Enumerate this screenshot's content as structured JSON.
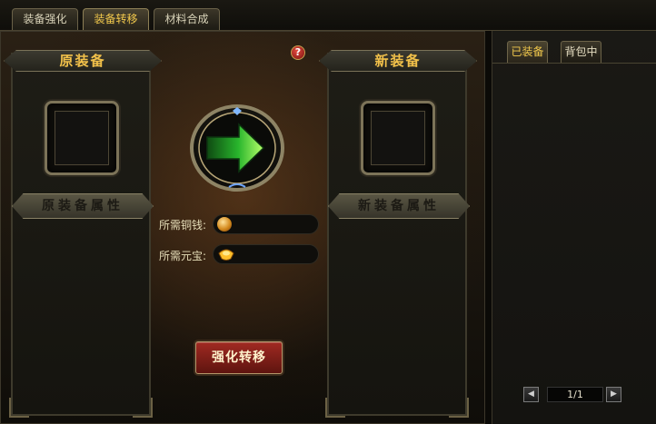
{
  "tabs": [
    {
      "label": "装备强化"
    },
    {
      "label": "装备转移"
    },
    {
      "label": "材料合成"
    }
  ],
  "active_tab": "装备转移",
  "left_panel": {
    "title": "原装备",
    "attr_label": "原装备属性"
  },
  "right_panel": {
    "title": "新装备",
    "attr_label": "新装备属性"
  },
  "help": {
    "label": "?"
  },
  "costs": {
    "copper_label": "所需铜钱:",
    "copper_value": "",
    "yuanbao_label": "所需元宝:",
    "yuanbao_value": ""
  },
  "action_button": "强化转移",
  "side": {
    "tabs": [
      {
        "label": "已装备"
      },
      {
        "label": "背包中"
      }
    ],
    "active_tab": "已装备",
    "pager": {
      "text": "1/1"
    }
  },
  "colors": {
    "accent_gold": "#f2c14a",
    "button_red": "#a12a22"
  },
  "icons": {
    "help": "question-icon",
    "arrow": "green-right-arrow-icon",
    "copper": "copper-coin-icon",
    "yuanbao": "gold-ingot-icon",
    "prev": "left-triangle-icon",
    "next": "right-triangle-icon"
  }
}
